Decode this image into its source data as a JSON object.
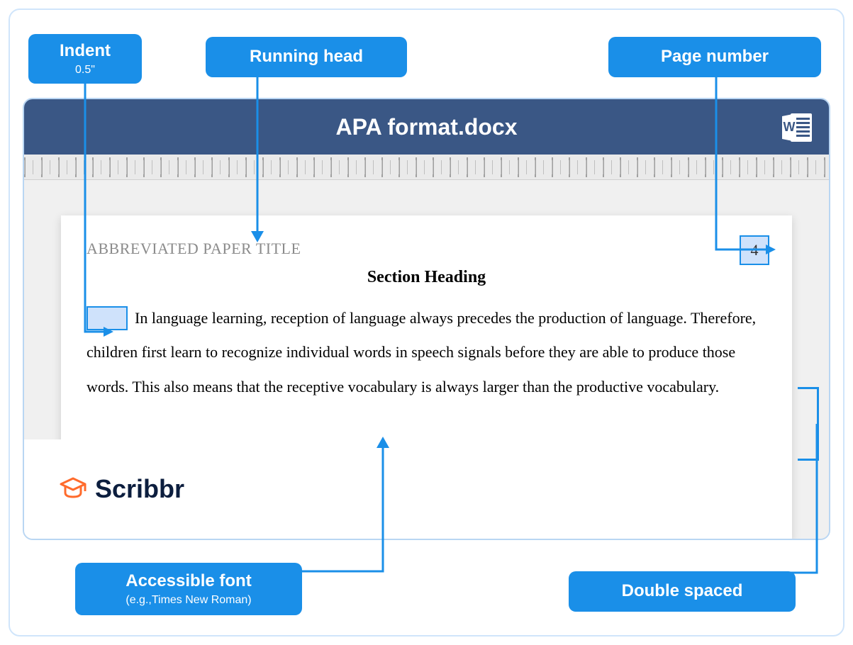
{
  "callouts": {
    "indent": {
      "label": "Indent",
      "sub": "0.5\""
    },
    "running_head": {
      "label": "Running head"
    },
    "page_number": {
      "label": "Page number"
    },
    "accessible_font": {
      "label": "Accessible font",
      "sub": "(e.g.,Times New Roman)"
    },
    "double_spaced": {
      "label": "Double spaced"
    }
  },
  "document": {
    "filename": "APA format.docx",
    "running_head_text": "ABBREVIATED PAPER TITLE",
    "page_number": "4",
    "section_heading": "Section Heading",
    "body_text": "In language learning, reception of language always precedes the production of language. Therefore, children first learn to recognize individual words in speech signals before they are able to produce those words. This also means that the receptive vocabulary is always larger than the productive vocabulary."
  },
  "brand": {
    "name": "Scribbr"
  }
}
